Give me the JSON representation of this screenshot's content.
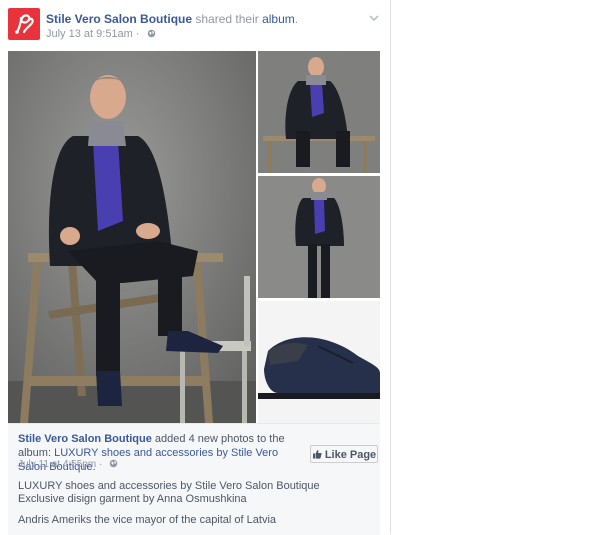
{
  "post": {
    "page_name": "Stile Vero Salon Boutique",
    "shared_text": "shared their",
    "album_link": "album",
    "period": ".",
    "timestamp": "July 13 at 9:51am",
    "separator": "·",
    "privacy_icon": "globe-icon",
    "menu_icon": "chevron-down-icon"
  },
  "photos": [
    {
      "subject": "man seated on wooden sawhorse, main photo"
    },
    {
      "subject": "man seated on bench"
    },
    {
      "subject": "man standing"
    },
    {
      "subject": "navy suede oxford shoe"
    }
  ],
  "attachment": {
    "page_name": "Stile Vero Salon Boutique",
    "added_text": "added 4 new photos to the album:",
    "album_title": "LUXURY shoes and accessories by Stile Vero Salon Boutique",
    "period": ".",
    "timestamp": "July 11 at 4:55pm",
    "separator": "·",
    "like_button": "Like Page",
    "description_line1": "LUXURY shoes and accessories by Stile Vero Salon Boutique",
    "description_line2": "Exclusive disign garment by Anna Osmushkina",
    "description_line3": "Andris Ameriks the vice mayor of the capital of Latvia"
  },
  "colors": {
    "link": "#3b5998",
    "muted": "#9197a3",
    "logo_bg": "#e8323c"
  }
}
